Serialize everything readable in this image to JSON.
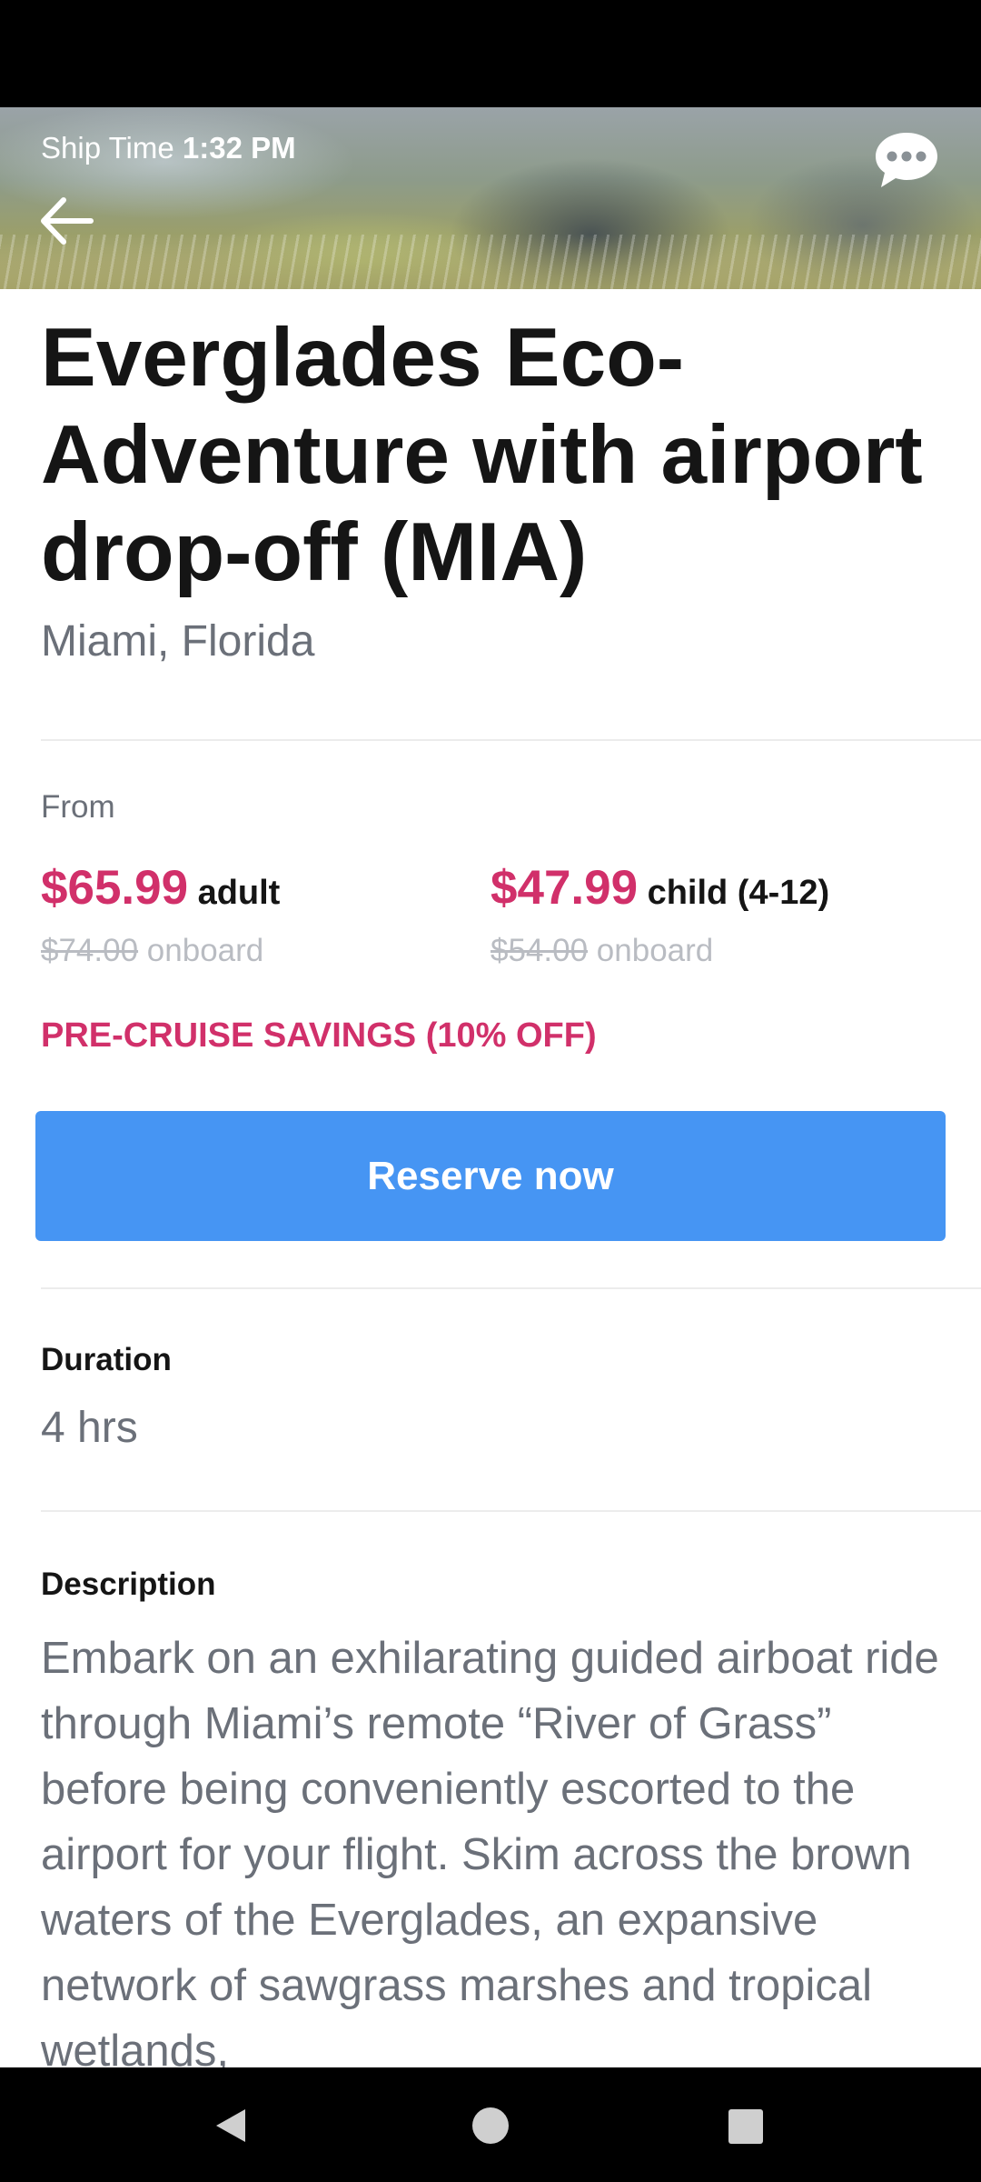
{
  "header": {
    "ship_time_label": "Ship Time",
    "ship_time_value": "1:32 PM",
    "back_icon": "arrow-left-icon",
    "chat_icon": "chat-bubble-icon"
  },
  "excursion": {
    "title": "Everglades Eco-Adventure with airport drop-off (MIA)",
    "location": "Miami, Florida"
  },
  "pricing": {
    "from_label": "From",
    "adult": {
      "price": "$65.99",
      "unit": "adult",
      "onboard_price": "$74.00",
      "onboard_label": "onboard"
    },
    "child": {
      "price": "$47.99",
      "unit": "child (4-12)",
      "onboard_price": "$54.00",
      "onboard_label": "onboard"
    },
    "savings": "PRE-CRUISE SAVINGS (10% OFF)",
    "reserve_label": "Reserve now"
  },
  "duration": {
    "label": "Duration",
    "value": "4 hrs"
  },
  "description": {
    "label": "Description",
    "text": "Embark on an exhilarating guided airboat ride through Miami’s remote “River of Grass” before being conveniently escorted to the airport for your flight. Skim across the brown waters of the Everglades, an expansive network of sawgrass marshes and tropical wetlands,"
  },
  "colors": {
    "accent": "#d1306a",
    "button": "#4695f3",
    "muted_text": "#6b7079"
  },
  "nav": {
    "back_icon": "nav-back-triangle-icon",
    "home_icon": "nav-home-circle-icon",
    "recents_icon": "nav-recents-square-icon"
  }
}
